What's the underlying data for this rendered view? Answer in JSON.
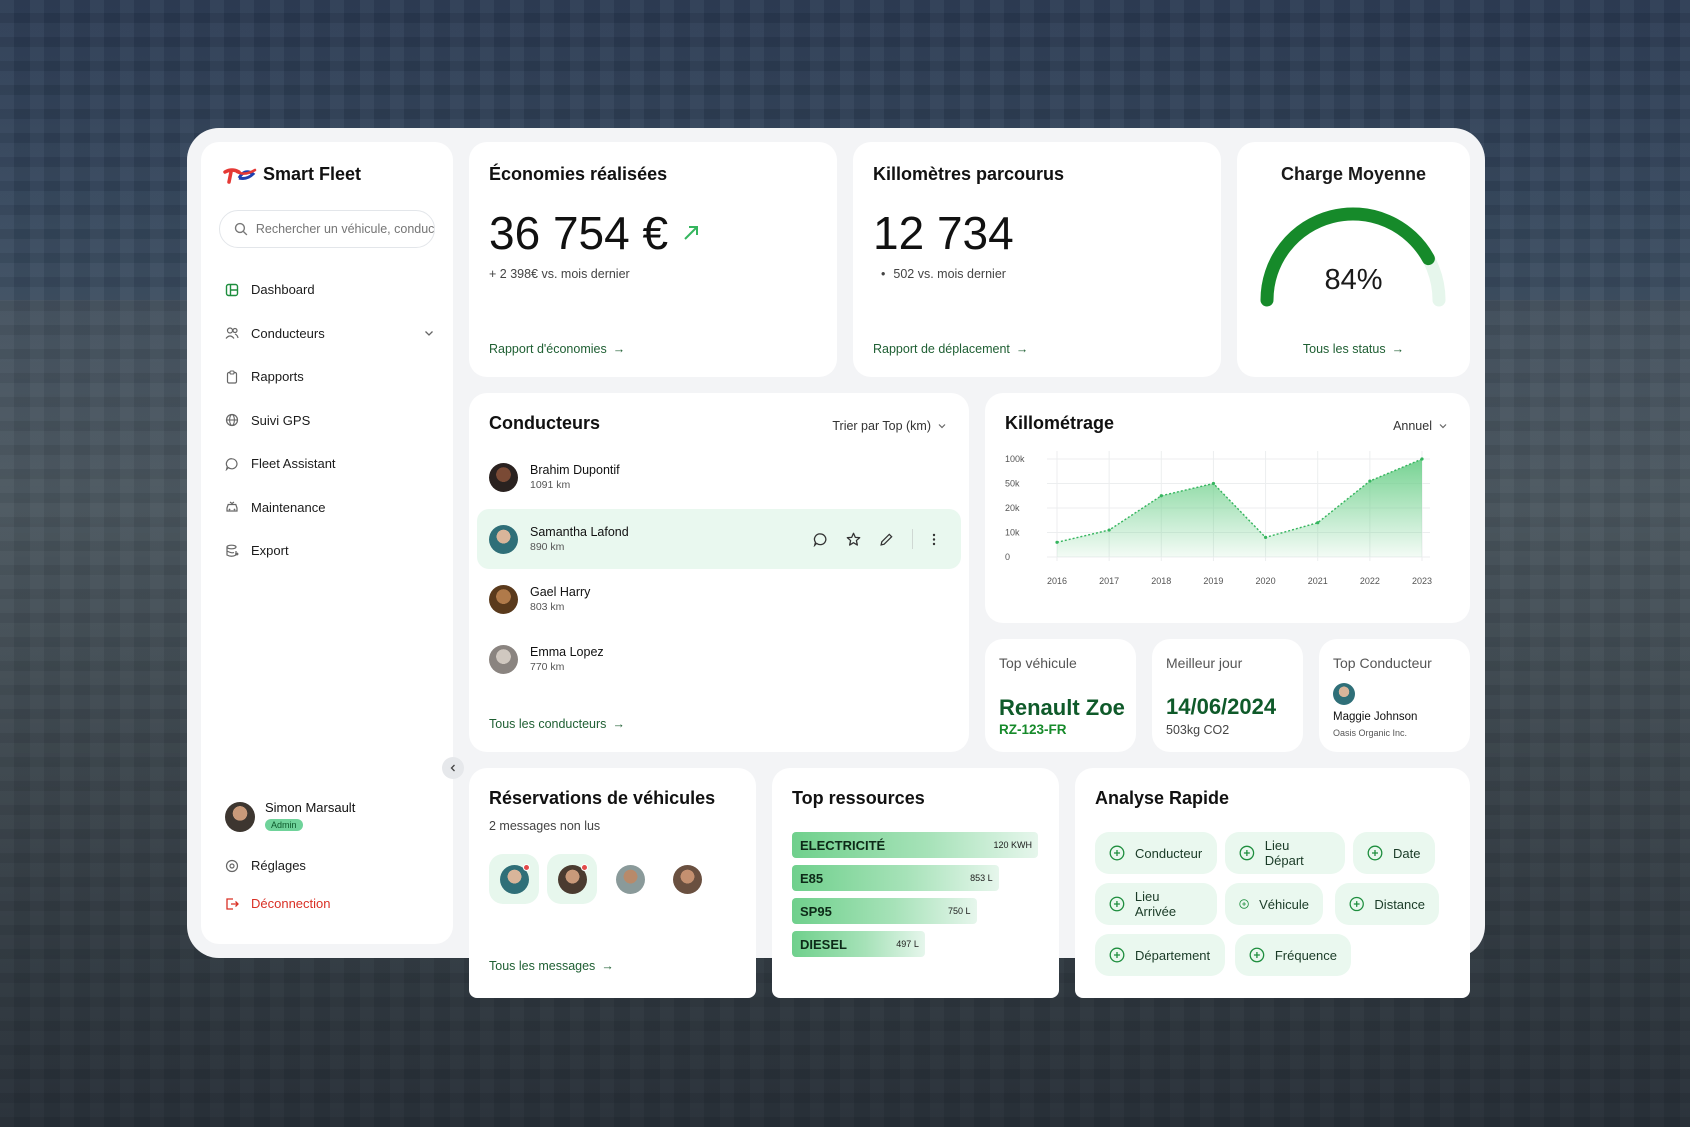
{
  "brand": {
    "name": "Smart Fleet",
    "accent": "#1e8e3e",
    "logo_red": "#e53935",
    "logo_blue": "#1e40af"
  },
  "search": {
    "placeholder": "Rechercher un véhicule, conducteur..."
  },
  "nav": {
    "dashboard": "Dashboard",
    "conducteurs": "Conducteurs",
    "rapports": "Rapports",
    "suivi_gps": "Suivi GPS",
    "fleet_assistant": "Fleet Assistant",
    "maintenance": "Maintenance",
    "export": "Export"
  },
  "user": {
    "name": "Simon Marsault",
    "role": "Admin"
  },
  "settings_label": "Réglages",
  "logout_label": "Déconnection",
  "economies": {
    "title": "Économies réalisées",
    "value": "36 754 €",
    "sub": "+ 2 398€ vs. mois dernier",
    "link": "Rapport d'économies"
  },
  "kilometres": {
    "title": "Killomètres parcourus",
    "value": "12 734",
    "sub": "502 vs. mois dernier",
    "link": "Rapport de déplacement"
  },
  "charge": {
    "title": "Charge Moyenne",
    "value": "84%",
    "percent": 84,
    "link": "Tous les status"
  },
  "conducteurs": {
    "title": "Conducteurs",
    "sort_label": "Trier par Top (km)",
    "link": "Tous les conducteurs",
    "rows": [
      {
        "name": "Brahim Dupontif",
        "km": "1091 km"
      },
      {
        "name": "Samantha Lafond",
        "km": "890 km"
      },
      {
        "name": "Gael Harry",
        "km": "803 km"
      },
      {
        "name": "Emma Lopez",
        "km": "770 km"
      }
    ]
  },
  "chart_data": {
    "type": "area",
    "title": "Killométrage",
    "period_label": "Annuel",
    "x": [
      "2016",
      "2017",
      "2018",
      "2019",
      "2020",
      "2021",
      "2022",
      "2023"
    ],
    "y_ticks": [
      "0",
      "10k",
      "20k",
      "50k",
      "100k"
    ],
    "values_tick_position": [
      0.6,
      1.1,
      2.5,
      3.0,
      0.8,
      1.4,
      3.1,
      4.0
    ],
    "fill": "#6fd08c",
    "stroke": "#35b55e"
  },
  "top_vehicule": {
    "title": "Top véhicule",
    "name": "Renault Zoe",
    "plate": "RZ-123-FR"
  },
  "meilleur_jour": {
    "title": "Meilleur jour",
    "date": "14/06/2024",
    "co2": "503kg CO2"
  },
  "top_conducteur": {
    "title": "Top Conducteur",
    "name": "Maggie Johnson",
    "company": "Oasis Organic Inc."
  },
  "reservations": {
    "title": "Réservations de véhicules",
    "sub": "2 messages non lus",
    "link": "Tous les messages"
  },
  "ressources": {
    "title": "Top ressources",
    "items": [
      {
        "label": "ELECTRICITÉ",
        "value": "120 KWH",
        "share": 1.0
      },
      {
        "label": "E85",
        "value": "853 L",
        "share": 0.84
      },
      {
        "label": "SP95",
        "value": "750 L",
        "share": 0.75
      },
      {
        "label": "DIESEL",
        "value": "497 L",
        "share": 0.54
      }
    ]
  },
  "analyse": {
    "title": "Analyse Rapide",
    "chips": [
      "Conducteur",
      "Lieu Départ",
      "Date",
      "Lieu Arrivée",
      "Véhicule",
      "Distance",
      "Département",
      "Fréquence"
    ]
  }
}
